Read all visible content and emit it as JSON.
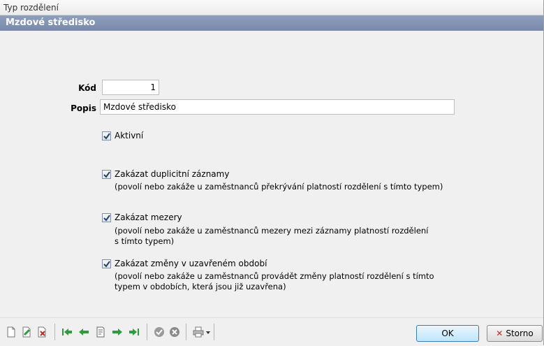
{
  "window": {
    "title": "Typ rozdělení"
  },
  "header": {
    "title": "Mzdové středisko"
  },
  "form": {
    "kod_label": "Kód",
    "kod_value": "1",
    "popis_label": "Popis",
    "popis_value": "Mzdové středisko"
  },
  "options": {
    "aktivni": {
      "label": "Aktivní",
      "checked": true
    },
    "duplicitni": {
      "label": "Zakázat duplicitní záznamy",
      "desc1": "(povolí nebo zakáže u zaměstnanců překrývání platností rozdělení s tímto typem)",
      "checked": true
    },
    "mezery": {
      "label": "Zakázat mezery",
      "desc1": "(povolí nebo zakáže u zaměstnanců mezery mezi záznamy platností rozdělení",
      "desc2": "s tímto typem)",
      "checked": true
    },
    "zmeny": {
      "label": "Zakázat změny v uzavřeném období",
      "desc1": "(povolí nebo zakáže u zaměstnanců provádět změny platností rozdělení s tímto",
      "desc2": "typem v obdobích, která jsou již uzavřena)",
      "checked": true
    }
  },
  "toolbar": {
    "icons": [
      "new-document-icon",
      "edit-document-icon",
      "delete-document-icon",
      "first-record-icon",
      "previous-record-icon",
      "detail-record-icon",
      "next-record-icon",
      "last-record-icon",
      "confirm-icon",
      "cancel-icon",
      "print-icon",
      "dropdown-arrow-icon"
    ],
    "ok_label": "OK",
    "storno_label": "Storno"
  },
  "colors": {
    "header_bg": "#7788aa",
    "nav_green": "#2e9b3c",
    "delete_red": "#cc2222"
  }
}
